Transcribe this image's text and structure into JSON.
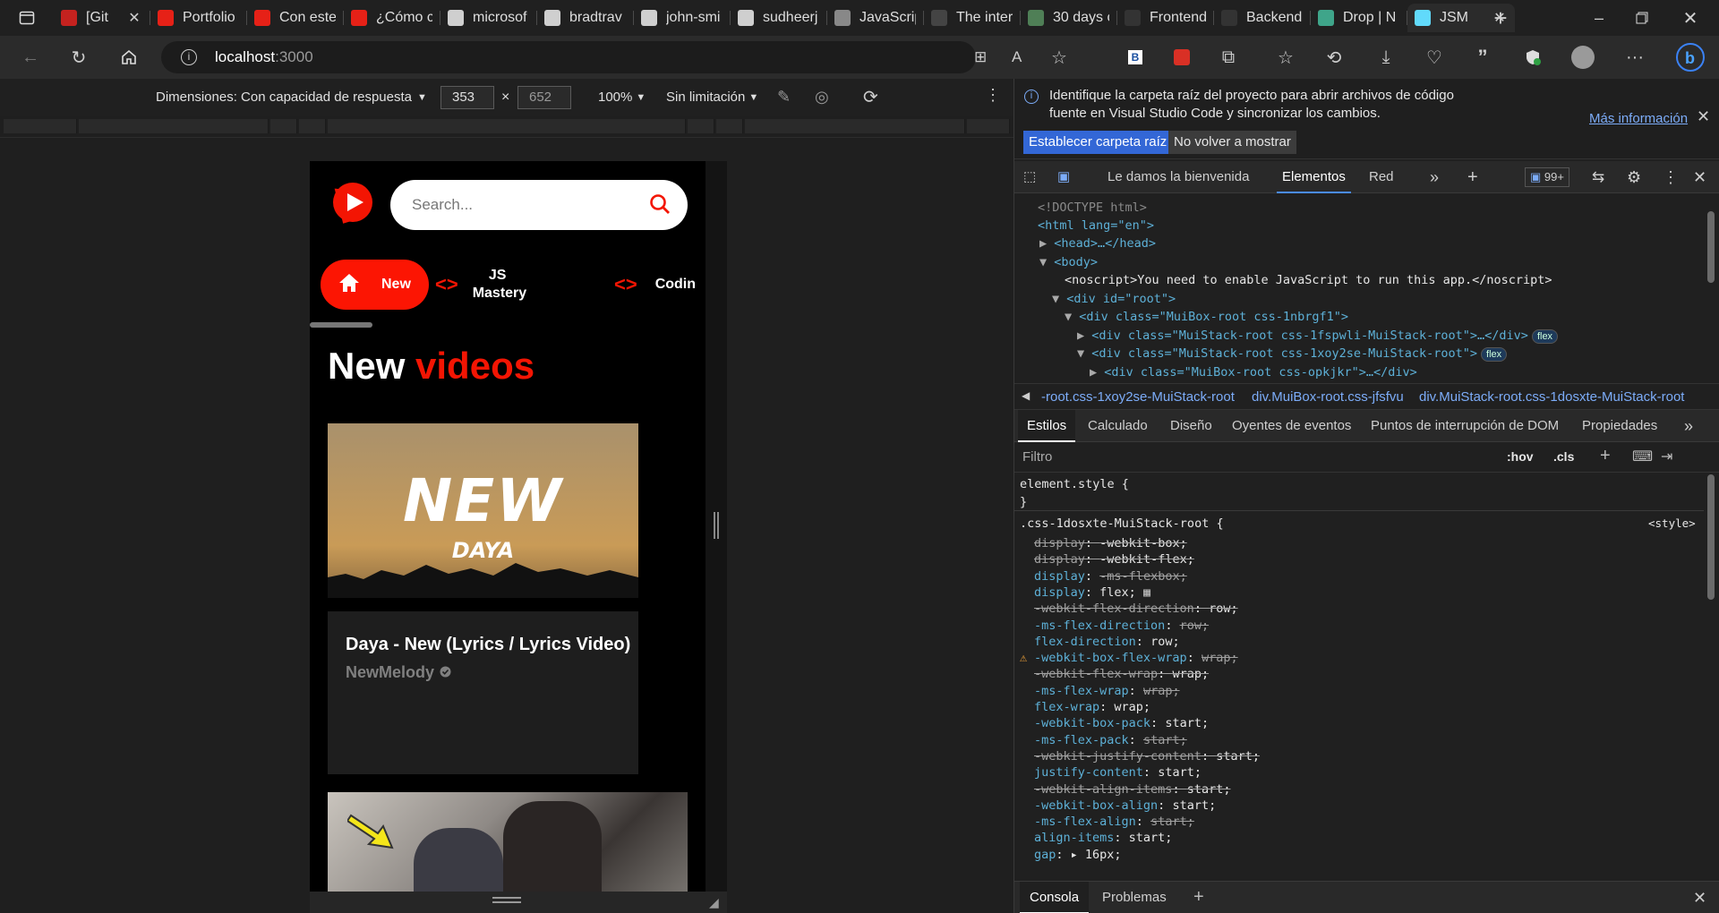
{
  "browser": {
    "tabs": [
      {
        "title": "[Git",
        "favicon": "gmail-icon",
        "color": "#c5221f"
      },
      {
        "title": "Portfolio",
        "favicon": "youtube-icon",
        "color": "#e62117"
      },
      {
        "title": "Con este",
        "favicon": "youtube-icon",
        "color": "#e62117"
      },
      {
        "title": "¿Cómo c",
        "favicon": "youtube-icon",
        "color": "#e62117"
      },
      {
        "title": "microsof",
        "favicon": "github-icon",
        "color": "#cfcfcf"
      },
      {
        "title": "bradtrav",
        "favicon": "github-icon",
        "color": "#cfcfcf"
      },
      {
        "title": "john-smi",
        "favicon": "github-icon",
        "color": "#cfcfcf"
      },
      {
        "title": "sudheerj",
        "favicon": "github-icon",
        "color": "#cfcfcf"
      },
      {
        "title": "JavaScrip",
        "favicon": "30-icon",
        "color": "#888888"
      },
      {
        "title": "The inter",
        "favicon": "u-icon",
        "color": "#444444"
      },
      {
        "title": "30 days c",
        "favicon": "notion-icon",
        "color": "#4f7f56"
      },
      {
        "title": "Frontend",
        "favicon": "r-icon",
        "color": "#333333"
      },
      {
        "title": "Backend",
        "favicon": "r-icon",
        "color": "#333333"
      },
      {
        "title": "Drop | N",
        "favicon": "diamond-icon",
        "color": "#3fa58a"
      },
      {
        "title": "JSM",
        "favicon": "react-icon",
        "color": "#61dafb",
        "active": true
      }
    ],
    "url_host": "localhost",
    "url_port": ":3000"
  },
  "device_toolbar": {
    "dimensions": "Dimensiones: Con capacidad de respuesta",
    "width": "353",
    "times": "×",
    "height": "652",
    "zoom": "100%",
    "throttle": "Sin limitación"
  },
  "app": {
    "search_placeholder": "Search...",
    "categories": [
      {
        "label": "New",
        "icon": "home-icon",
        "active": true
      },
      {
        "label": "JS Mastery",
        "icon": "code-icon"
      },
      {
        "label": "Codin",
        "icon": "code-icon"
      }
    ],
    "title_first": "New",
    "title_second": "videos",
    "video": {
      "thumb_big": "NEW",
      "thumb_small": "DAYA",
      "title": "Daya - New (Lyrics / Lyrics Video)",
      "channel": "NewMelody"
    },
    "accent": "#fc1503"
  },
  "devtools": {
    "info": "Identifique la carpeta raíz del proyecto para abrir archivos de código fuente en Visual Studio Code y sincronizar los cambios.",
    "more_info": "Más información",
    "btn_set_root": "Establecer carpeta raíz",
    "btn_dont_show": "No volver a mostrar",
    "tabs": [
      "Le damos la bienvenida",
      "Elementos",
      "Red"
    ],
    "badge": "99+",
    "dom": [
      "<!DOCTYPE html>",
      "<html lang=\"en\">",
      "<head>…</head>",
      "<body>",
      "<noscript>You need to enable JavaScript to run this app.</noscript>",
      "<div id=\"root\">",
      "<div class=\"MuiBox-root css-1nbrgf1\">",
      "<div class=\"MuiStack-root css-1fspwli-MuiStack-root\">…</div>",
      "<div class=\"MuiStack-root css-1xoy2se-MuiStack-root\">",
      "<div class=\"MuiBox-root css-opkjkr\">…</div>"
    ],
    "flex_label": "flex",
    "crumbs": [
      "-root.css-1xoy2se-MuiStack-root",
      "div.MuiBox-root.css-jfsfvu",
      "div.MuiStack-root.css-1dosxte-MuiStack-root"
    ],
    "subtabs": [
      "Estilos",
      "Calculado",
      "Diseño",
      "Oyentes de eventos",
      "Puntos de interrupción de DOM",
      "Propiedades"
    ],
    "filter_placeholder": "Filtro",
    "hov": ":hov",
    "cls": ".cls",
    "element_style": "element.style {",
    "close_brace": "}",
    "rule_selector": ".css-1dosxte-MuiStack-root {",
    "rule_source": "<style>",
    "props": [
      {
        "name": "display",
        "value": "-webkit-box;",
        "struck": true
      },
      {
        "name": "display",
        "value": "-webkit-flex;",
        "struck": true
      },
      {
        "name": "display",
        "value": "-ms-flexbox;",
        "struck_value": true
      },
      {
        "name": "display",
        "value": "flex;"
      },
      {
        "name": "-webkit-flex-direction",
        "value": "row;",
        "struck": true
      },
      {
        "name": "-ms-flex-direction",
        "value": "row;",
        "struck_value": true
      },
      {
        "name": "flex-direction",
        "value": "row;"
      },
      {
        "name": "-webkit-box-flex-wrap",
        "value": "wrap;",
        "warn": true,
        "struck_value": true
      },
      {
        "name": "-webkit-flex-wrap",
        "value": "wrap;",
        "struck": true
      },
      {
        "name": "-ms-flex-wrap",
        "value": "wrap;",
        "struck_value": true
      },
      {
        "name": "flex-wrap",
        "value": "wrap;"
      },
      {
        "name": "-webkit-box-pack",
        "value": "start;"
      },
      {
        "name": "-ms-flex-pack",
        "value": "start;",
        "struck_value": true
      },
      {
        "name": "-webkit-justify-content",
        "value": "start;",
        "struck": true
      },
      {
        "name": "justify-content",
        "value": "start;"
      },
      {
        "name": "-webkit-align-items",
        "value": "start;",
        "struck": true
      },
      {
        "name": "-webkit-box-align",
        "value": "start;"
      },
      {
        "name": "-ms-flex-align",
        "value": "start;",
        "struck_value": true
      },
      {
        "name": "align-items",
        "value": "start;"
      },
      {
        "name": "gap",
        "value": "▸ 16px;"
      }
    ],
    "drawer_tabs": [
      "Consola",
      "Problemas"
    ]
  }
}
